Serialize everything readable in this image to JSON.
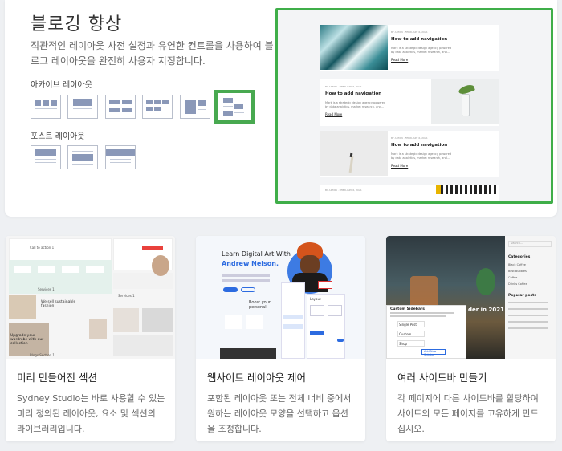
{
  "hero": {
    "title": "블로깅 향상",
    "description": "직관적인 레이아웃 사전 설정과 유연한 컨트롤을 사용하여 블로그 레이아웃을 완전히 사용자 지정합니다.",
    "archive_label": "아카이브 레이아웃",
    "post_label": "포스트 레이아웃",
    "selected_archive_layout": 6
  },
  "preview": {
    "post_title": "How to add navigation",
    "post_excerpt": "Mark is a strategic design agency powered by data analytics, market research, and...",
    "read_more": "Read More",
    "meta_author": "BY ADMIN",
    "meta_date": "FEBRUARY 6, 2021"
  },
  "features": [
    {
      "title": "미리 만들어진 섹션",
      "description": "Sydney Studio는 바로 사용할 수 있는 미리 정의된 레이아웃, 요소 및 섹션의 라이브러리입니다.",
      "shot": {
        "call_to_action": "Call to action 1",
        "services": "Services 1",
        "sustainable": "We sell sustainable fashion",
        "upgrade": "Upgrade your wardrobe with our collection",
        "blog": "Blogs Section 1"
      }
    },
    {
      "title": "웹사이트 레이아웃 제어",
      "description": "포함된 레이아웃 또는 전체 너비 중에서 원하는 레이아웃 모양을 선택하고 옵션을 조정합니다.",
      "shot": {
        "headline1": "Learn Digital Art With",
        "headline2": "Andrew Nelson.",
        "boost": "Boost your personal",
        "layout": "Layout"
      }
    },
    {
      "title": "여러 사이드바 만들기",
      "description": "각 페이지에 다른 사이드바를 할당하여 사이트의 모든 페이지를 고유하게 만드십시오.",
      "shot": {
        "panel_title": "Custom Sidebars",
        "rows": [
          "Single Post",
          "Custom",
          "Shop"
        ],
        "add_button": "Add New Sidebar",
        "search": "Search...",
        "categories": "Categories",
        "cat_items": [
          "Black Coffee",
          "Best Bubbles",
          "Coffee",
          "Drinks Coffee"
        ],
        "popular": "Popular posts",
        "headline_fragment": "der in 2021"
      }
    }
  ]
}
